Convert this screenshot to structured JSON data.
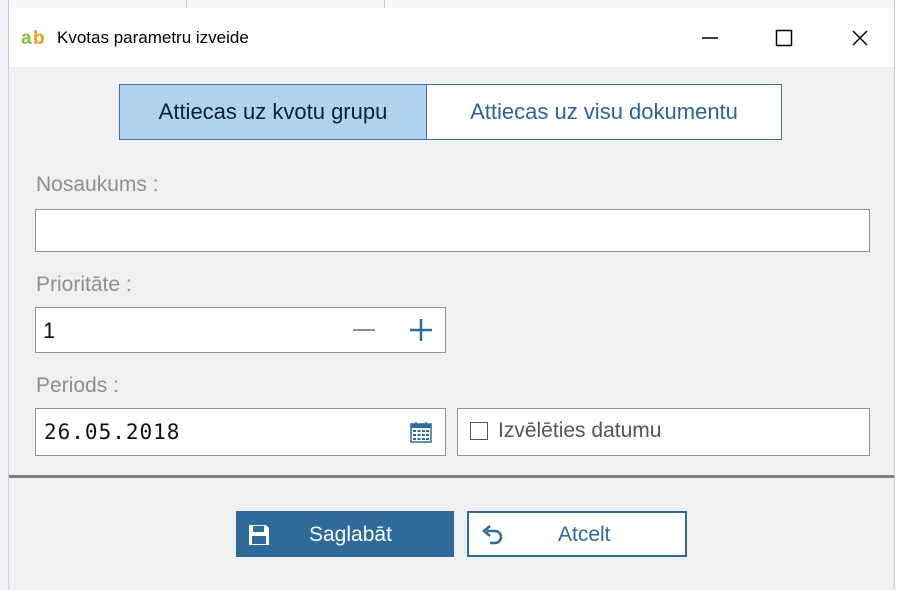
{
  "window": {
    "title": "Kvotas parametru izveide",
    "logo": "ab-logo",
    "controls": [
      "minimize-icon",
      "maximize-icon",
      "close-icon"
    ]
  },
  "tabs": [
    {
      "label": "Attiecas uz kvotu grupu",
      "active": true
    },
    {
      "label": "Attiecas uz visu dokumentu",
      "active": false
    }
  ],
  "form": {
    "name_label": "Nosaukums :",
    "name_value": "",
    "priority_label": "Prioritāte :",
    "priority_value": "1",
    "period_label": "Periods :",
    "date_value": "26.05.2018",
    "choose_date_label": "Izvēlēties datumu",
    "choose_date_checked": false
  },
  "buttons": {
    "save_label": "Saglabāt",
    "cancel_label": "Atcelt"
  },
  "colors": {
    "accent": "#2f6a9b",
    "active_tab_bg": "#afd2ee",
    "tab_text": "#2a6499",
    "label_text": "#8b8f94"
  }
}
